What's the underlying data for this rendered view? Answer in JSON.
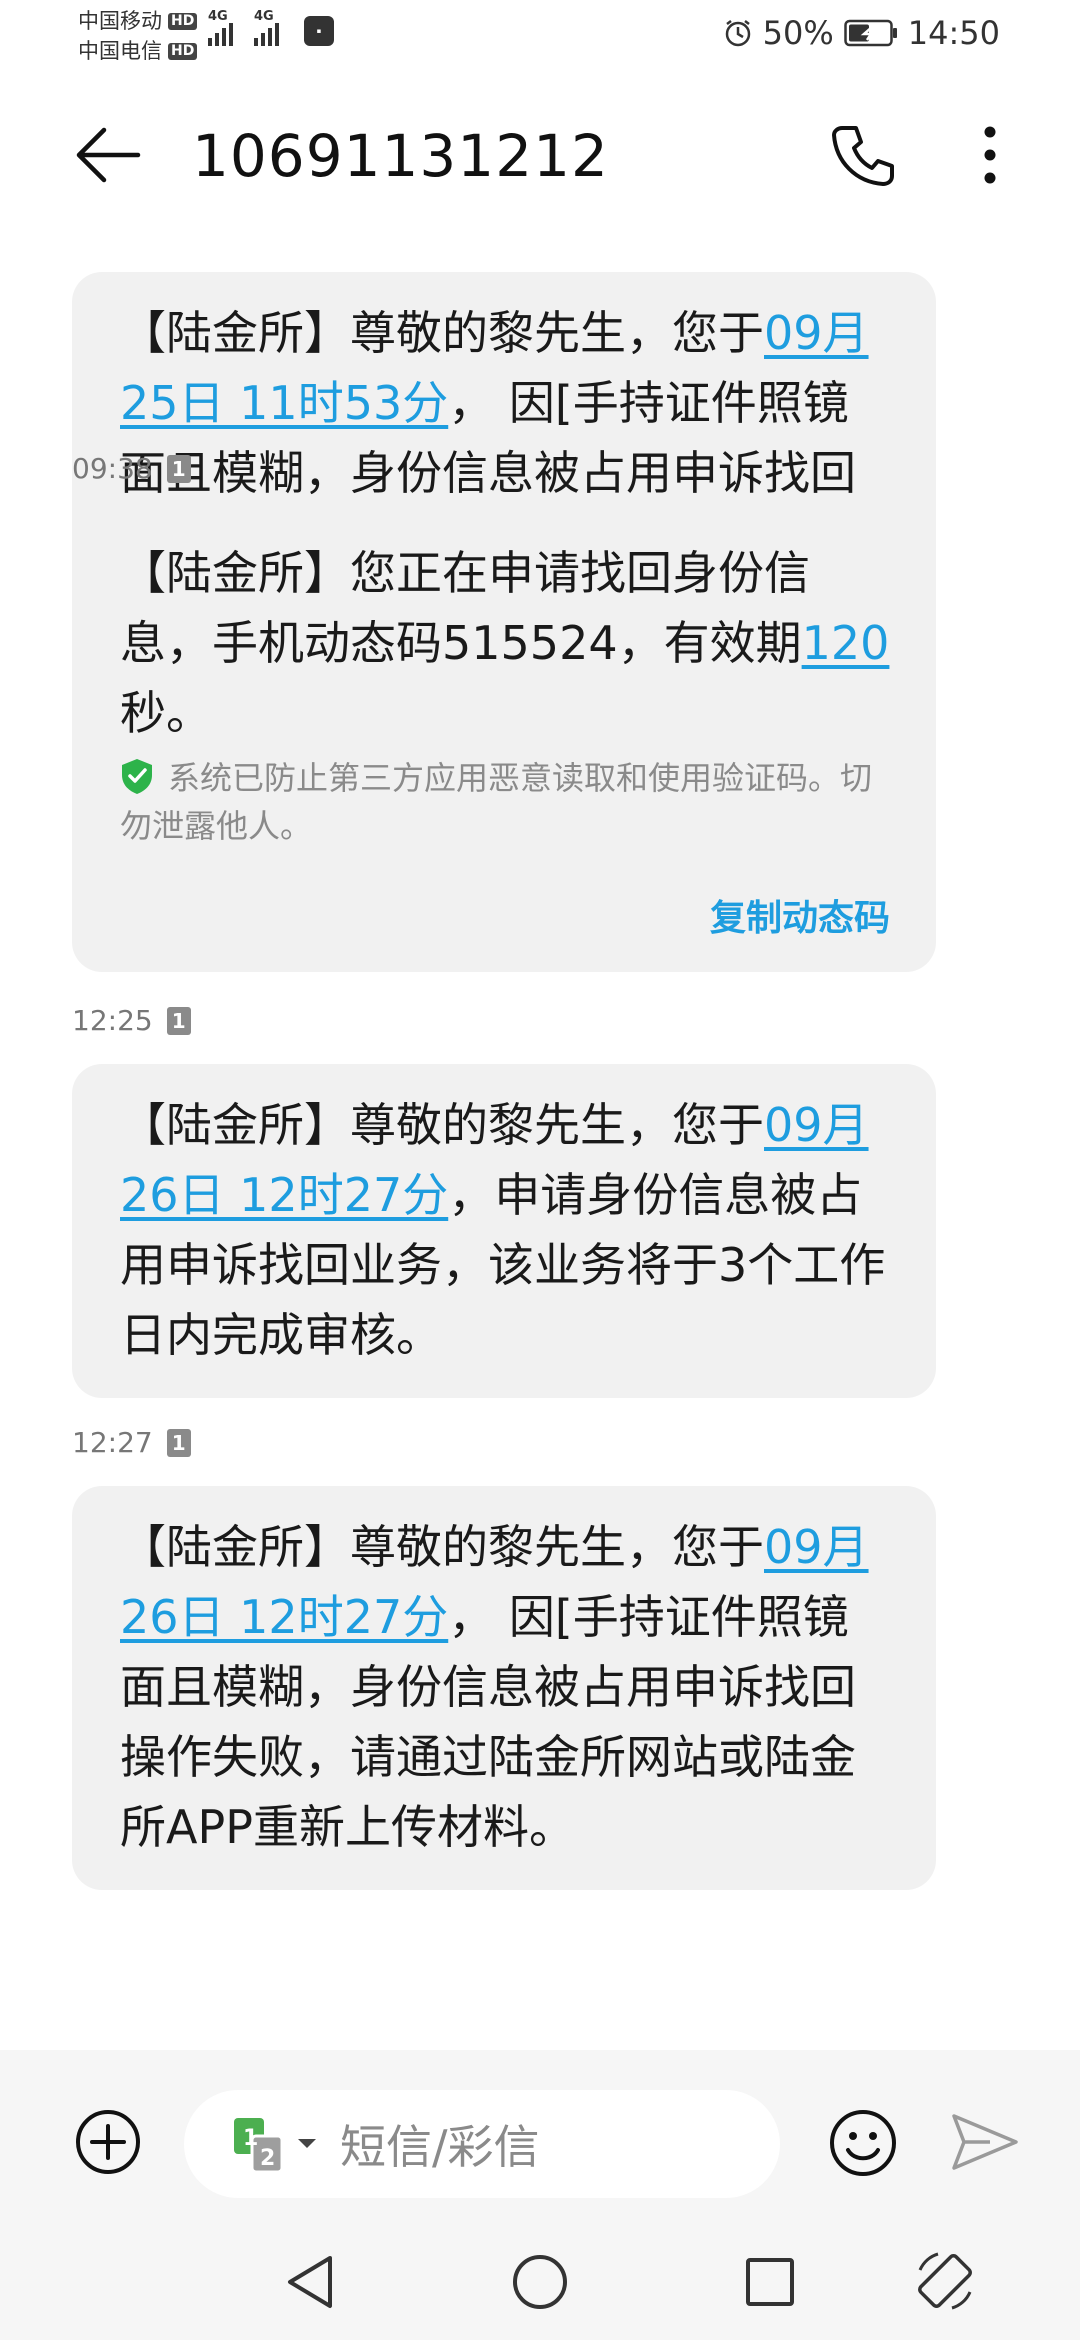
{
  "status_bar": {
    "carrier1": "中国移动",
    "carrier2": "中国电信",
    "hd": "HD",
    "net1": "4G",
    "net2": "4G",
    "battery": "50%",
    "time": "14:50"
  },
  "header": {
    "title": "10691131212"
  },
  "messages": [
    {
      "text_before": "【陆金所】尊敬的黎先生，您于",
      "link": "09月25日 11时53分",
      "text_after": "， 因[手持证件照镜面且模糊，身份信息被占用申诉找回操作失败，请通过陆金所网站或陆金所APP重新上传材料。",
      "time": "09:38",
      "sim": "1"
    },
    {
      "text_before": "【陆金所】您正在申请找回身份信息，手机动态码515524，有效期",
      "link": "120",
      "text_after": "秒。",
      "notice": "系统已防止第三方应用恶意读取和使用验证码。切勿泄露他人。",
      "copy_label": "复制动态码",
      "time": "12:25",
      "sim": "1"
    },
    {
      "text_before": "【陆金所】尊敬的黎先生，您于",
      "link": "09月26日 12时27分",
      "text_after": "，申请身份信息被占用申诉找回业务，该业务将于3个工作日内完成审核。",
      "time": "12:27",
      "sim": "1"
    },
    {
      "text_before": "【陆金所】尊敬的黎先生，您于",
      "link": "09月26日 12时27分",
      "text_after": "， 因[手持证件照镜面且模糊，身份信息被占用申诉找回操作失败，请通过陆金所网站或陆金所APP重新上传材料。"
    }
  ],
  "input": {
    "placeholder": "短信/彩信",
    "sim_primary": "1",
    "sim_secondary": "2"
  },
  "colors": {
    "link": "#1e9ddf",
    "bubble": "#f1f1f1",
    "shield": "#2db34a"
  },
  "icons": [
    "back-arrow-icon",
    "phone-icon",
    "more-vertical-icon",
    "shield-check-icon",
    "plus-circle-icon",
    "sim-switch-icon",
    "emoji-icon",
    "send-icon",
    "nav-back-icon",
    "nav-home-icon",
    "nav-recent-icon",
    "rotate-icon",
    "alarm-icon",
    "battery-icon"
  ]
}
